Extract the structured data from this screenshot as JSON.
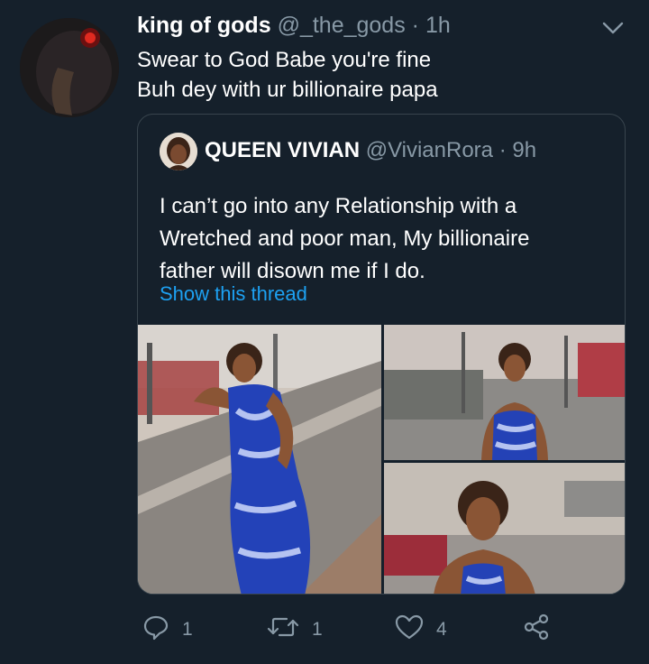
{
  "tweet": {
    "display_name": "king of gods",
    "handle": "@_the_gods",
    "separator": "·",
    "time": "1h",
    "lines": [
      "Swear to God Babe you're fine",
      "Buh dey with ur billionaire papa"
    ]
  },
  "quoted": {
    "display_name": "QUEEN VIVIAN",
    "handle": "@VivianRora",
    "separator": "·",
    "time": "9h",
    "lines": [
      "I can’t go into any Relationship with a",
      "Wretched and poor man,  My billionaire",
      "father will disown me if I do."
    ],
    "thread_link": "Show this thread"
  },
  "actions": {
    "reply_icon": "reply-icon",
    "reply_count": "1",
    "retweet_icon": "retweet-icon",
    "retweet_count": "1",
    "like_icon": "heart-icon",
    "like_count": "4",
    "share_icon": "share-icon"
  },
  "colors": {
    "background": "#15202b",
    "secondary_text": "#8899a6",
    "link": "#1da1f2",
    "border": "#38444d"
  }
}
